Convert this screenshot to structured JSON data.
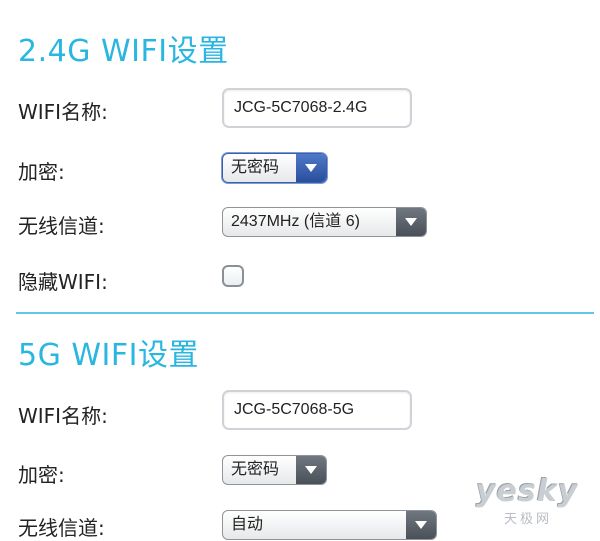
{
  "section_24g": {
    "title": "2.4G WIFI设置",
    "ssid_label": "WIFI名称:",
    "ssid_value": "JCG-5C7068-2.4G",
    "encryption_label": "加密:",
    "encryption_value": "无密码",
    "channel_label": "无线信道:",
    "channel_value": "2437MHz (信道 6)",
    "hide_label": "隐藏WIFI:",
    "hide_checked": false
  },
  "section_5g": {
    "title": "5G WIFI设置",
    "ssid_label": "WIFI名称:",
    "ssid_value": "JCG-5C7068-5G",
    "encryption_label": "加密:",
    "encryption_value": "无密码",
    "channel_label": "无线信道:",
    "channel_value": "自动"
  },
  "watermark": {
    "logo": "yesky",
    "sub": "天极网"
  },
  "colors": {
    "title": "#29b6e0",
    "divider": "#5cc8ea",
    "active_select": "#3b5fa8"
  }
}
